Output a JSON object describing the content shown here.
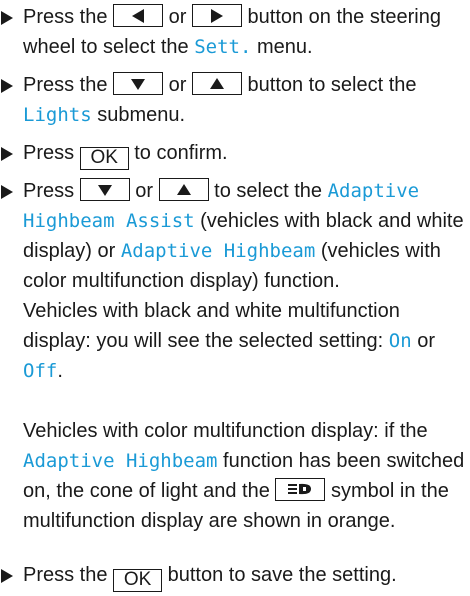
{
  "accent_color": "#1a9ad6",
  "icons": {
    "bullet": "triangle-right-icon",
    "left_button": "triangle-left-icon",
    "right_button": "triangle-right-icon",
    "down_button": "triangle-down-icon",
    "up_button": "triangle-up-icon",
    "highbeam_symbol": "adaptive-highbeam-icon"
  },
  "step1": {
    "t1": "Press the ",
    "or": " or ",
    "t2": " button on the steering wheel to select the ",
    "menu": "Sett.",
    "t3": " menu."
  },
  "step2": {
    "t1": "Press the ",
    "or": " or ",
    "t2": " button to select the ",
    "submenu": "Lights",
    "t3": " submenu."
  },
  "step3": {
    "t1": "Press ",
    "ok": "OK",
    "t2": " to confirm."
  },
  "step4": {
    "t1": "Press ",
    "or": " or ",
    "t2": " to select the ",
    "func1": "Adaptive Highbeam Assist",
    "t3": " (vehicles with black and white display) or ",
    "func2": "Adaptive Highbeam",
    "t4": " (vehicles with color multifunction display) function.",
    "bw_note": "Vehicles with black and white multifunction display: you will see the selected setting: ",
    "on": "On",
    "or2": " or ",
    "off": "Off",
    "end": ".",
    "color_note1": "Vehicles with color multifunction display: if the ",
    "func3": "Adaptive Highbeam",
    "color_note2": " function has been switched on, the cone of light and the ",
    "color_note3": " symbol in the multifunction display are shown in orange."
  },
  "step5": {
    "t1": "Press the ",
    "ok": "OK",
    "t2": " button to save the setting."
  }
}
